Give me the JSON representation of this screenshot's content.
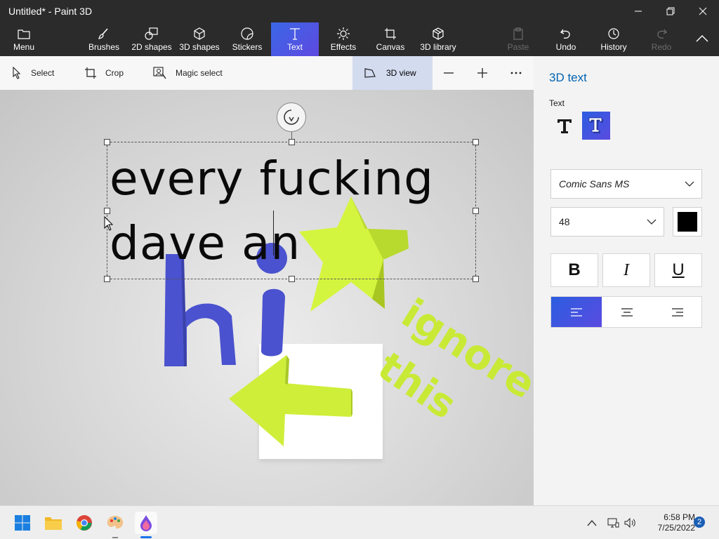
{
  "window": {
    "title": "Untitled* - Paint 3D"
  },
  "ribbon": {
    "menu_label": "Menu",
    "items": [
      {
        "label": "Brushes",
        "icon": "brush-icon"
      },
      {
        "label": "2D shapes",
        "icon": "shapes-2d-icon"
      },
      {
        "label": "3D shapes",
        "icon": "cube-icon"
      },
      {
        "label": "Stickers",
        "icon": "sticker-icon"
      },
      {
        "label": "Text",
        "icon": "text-icon",
        "active": true
      },
      {
        "label": "Effects",
        "icon": "sun-icon"
      },
      {
        "label": "Canvas",
        "icon": "canvas-icon"
      },
      {
        "label": "3D library",
        "icon": "library-icon"
      }
    ],
    "paste_label": "Paste",
    "undo_label": "Undo",
    "history_label": "History",
    "redo_label": "Redo"
  },
  "toolbar": {
    "select_label": "Select",
    "crop_label": "Crop",
    "magic_select_label": "Magic select",
    "view3d_label": "3D view"
  },
  "canvas": {
    "text_line1": "every fucking",
    "text_line2": "dave an",
    "shape_text_hi": "hi",
    "shape_text_ignore": "ignore",
    "shape_text_this": "this",
    "accent_yellow_green": "#d4f53f",
    "accent_blue": "#4a52cf"
  },
  "panel": {
    "title": "3D text",
    "text_label": "Text",
    "font_family": "Comic Sans MS",
    "font_size": "48",
    "text_color": "#000000",
    "bold_label": "B",
    "italic_label": "I",
    "underline_label": "U"
  },
  "taskbar": {
    "time": "6:58 PM",
    "date": "7/25/2022",
    "notification_count": "2"
  }
}
